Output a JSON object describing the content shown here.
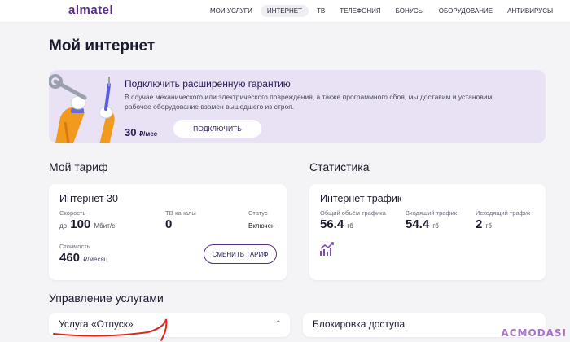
{
  "header": {
    "logo": "almatel",
    "nav": [
      "МОИ УСЛУГИ",
      "ИНТЕРНЕТ",
      "ТВ",
      "ТЕЛЕФОНИЯ",
      "БОНУСЫ",
      "ОБОРУДОВАНИЕ",
      "АНТИВИРУСЫ"
    ],
    "active_nav": "ИНТЕРНЕТ"
  },
  "page": {
    "title": "Мой интернет"
  },
  "promo": {
    "title": "Подключить расширенную гарантию",
    "text": "В случае механического или электрического повреждения, а также программного сбоя, мы доставим и установим рабочее оборудование взамен вышедшего из строя.",
    "price": "30",
    "price_unit": "₽/мес",
    "button": "ПОДКЛЮЧИТЬ"
  },
  "tariff": {
    "section_title": "Мой тариф",
    "name": "Интернет 30",
    "speed_label": "Скорость",
    "speed_prefix": "до",
    "speed_value": "100",
    "speed_unit": "Мбит/с",
    "tv_label": "ТВ-каналы",
    "tv_value": "0",
    "status_label": "Статус",
    "status_value": "Включен",
    "cost_label": "Стоимость",
    "cost_value": "460",
    "cost_unit": "₽/месяц",
    "change_button": "СМЕНИТЬ ТАРИФ"
  },
  "stats": {
    "section_title": "Статистика",
    "card_title": "Интернет трафик",
    "total_label": "Общий объём трафика",
    "total_value": "56.4",
    "total_unit": "гб",
    "in_label": "Входящий трафик",
    "in_value": "54.4",
    "in_unit": "гб",
    "out_label": "Исходящий трафик",
    "out_value": "2",
    "out_unit": "гб"
  },
  "services": {
    "section_title": "Управление услугами",
    "items": [
      {
        "label": "Услуга «Отпуск»"
      },
      {
        "label": "Блокировка доступа"
      }
    ]
  },
  "watermark": "ACMODASI",
  "colors": {
    "brand": "#5b2c83",
    "promo_bg": "#e9e2f4",
    "page_bg": "#f4f4f7",
    "annotation": "#e0261b"
  },
  "icons": [
    "wrench-screwdriver-hand-icon",
    "chart-trend-icon",
    "chevron-up-icon"
  ]
}
